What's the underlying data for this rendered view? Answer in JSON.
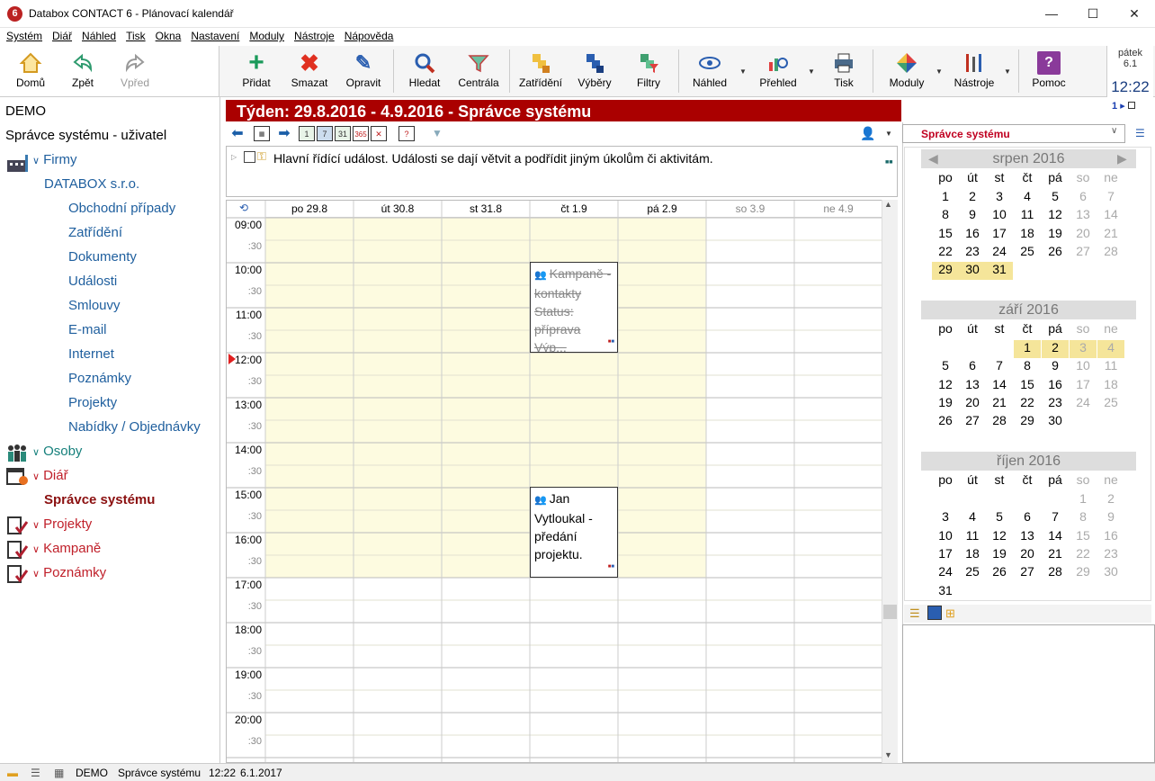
{
  "window": {
    "title": "Databox CONTACT 6 - Plánovací kalendář",
    "minimize": "—",
    "maximize": "☐",
    "close": "✕"
  },
  "menu": [
    "Systém",
    "Diář",
    "Náhled",
    "Tisk",
    "Okna",
    "Nastavení",
    "Moduly",
    "Nástroje",
    "Nápověda"
  ],
  "nav_buttons": {
    "home": "Domů",
    "back": "Zpět",
    "forward": "Vpřed"
  },
  "toolbar": {
    "add": "Přidat",
    "delete": "Smazat",
    "edit": "Opravit",
    "search": "Hledat",
    "central": "Centrála",
    "categorize": "Zatřídění",
    "selections": "Výběry",
    "filters": "Filtry",
    "preview": "Náhled",
    "overview": "Přehled",
    "print": "Tisk",
    "modules": "Moduly",
    "tools": "Nástroje",
    "help": "Pomoc"
  },
  "clock": {
    "day": "pátek",
    "date": "6.1",
    "time": "12:22"
  },
  "leftnav": {
    "db": "DEMO",
    "user": "Správce systému - uživatel",
    "firms": "Firmy",
    "company": "DATABOX s.r.o.",
    "items": [
      "Obchodní případy",
      "Zatřídění",
      "Dokumenty",
      "Události",
      "Smlouvy",
      "E-mail",
      "Internet",
      "Poznámky",
      "Projekty",
      "Nabídky / Objednávky"
    ],
    "persons": "Osoby",
    "diary": "Diář",
    "diary_user": "Správce systému",
    "projects": "Projekty",
    "campaigns": "Kampaně",
    "notes": "Poznámky"
  },
  "week_header": "Týden: 29.8.2016 - 4.9.2016 - Správce systému",
  "header_indicator": "1",
  "main_event": "Hlavní řídící událost. Události se dají větvit a podřídit jiným úkolům či aktivitám.",
  "days": [
    "po 29.8",
    "út 30.8",
    "st 31.8",
    "čt 1.9",
    "pá 2.9",
    "so 3.9",
    "ne 4.9"
  ],
  "hours": [
    "09:00",
    "10:00",
    "11:00",
    "12:00",
    "13:00",
    "14:00",
    "15:00",
    "16:00",
    "17:00",
    "18:00",
    "19:00",
    "20:00"
  ],
  "half_label": ":30",
  "events": [
    {
      "text": "Kampaně - kontakty Status: příprava Výp...",
      "day": 3,
      "start": "10:00",
      "end": "12:00",
      "strike": true
    },
    {
      "text": "Jan Vytloukal - předání projektu.",
      "day": 3,
      "start": "15:00",
      "end": "17:00",
      "strike": false
    }
  ],
  "right": {
    "user_select": "Správce systému",
    "dow": [
      "po",
      "út",
      "st",
      "čt",
      "pá",
      "so",
      "ne"
    ],
    "months": [
      {
        "name": "srpen 2016",
        "rows": [
          [
            "1",
            "2",
            "3",
            "4",
            "5",
            "6",
            "7"
          ],
          [
            "8",
            "9",
            "10",
            "11",
            "12",
            "13",
            "14"
          ],
          [
            "15",
            "16",
            "17",
            "18",
            "19",
            "20",
            "21"
          ],
          [
            "22",
            "23",
            "24",
            "25",
            "26",
            "27",
            "28"
          ],
          [
            "29",
            "30",
            "31",
            "",
            "",
            "",
            ""
          ]
        ]
      },
      {
        "name": "září 2016",
        "rows": [
          [
            "",
            "",
            "",
            "1",
            "2",
            "3",
            "4"
          ],
          [
            "5",
            "6",
            "7",
            "8",
            "9",
            "10",
            "11"
          ],
          [
            "12",
            "13",
            "14",
            "15",
            "16",
            "17",
            "18"
          ],
          [
            "19",
            "20",
            "21",
            "22",
            "23",
            "24",
            "25"
          ],
          [
            "26",
            "27",
            "28",
            "29",
            "30",
            "",
            ""
          ]
        ]
      },
      {
        "name": "říjen 2016",
        "rows": [
          [
            "",
            "",
            "",
            "",
            "",
            "1",
            "2"
          ],
          [
            "3",
            "4",
            "5",
            "6",
            "7",
            "8",
            "9"
          ],
          [
            "10",
            "11",
            "12",
            "13",
            "14",
            "15",
            "16"
          ],
          [
            "17",
            "18",
            "19",
            "20",
            "21",
            "22",
            "23"
          ],
          [
            "24",
            "25",
            "26",
            "27",
            "28",
            "29",
            "30"
          ],
          [
            "31",
            "",
            "",
            "",
            "",
            "",
            ""
          ]
        ]
      }
    ]
  },
  "status": {
    "db": "DEMO",
    "user": "Správce systému",
    "time": "12:22",
    "date": "6.1.2017"
  },
  "colors": {
    "accent": "#a00000",
    "workday": "#fdfbe0",
    "selected": "#f5e59a"
  }
}
